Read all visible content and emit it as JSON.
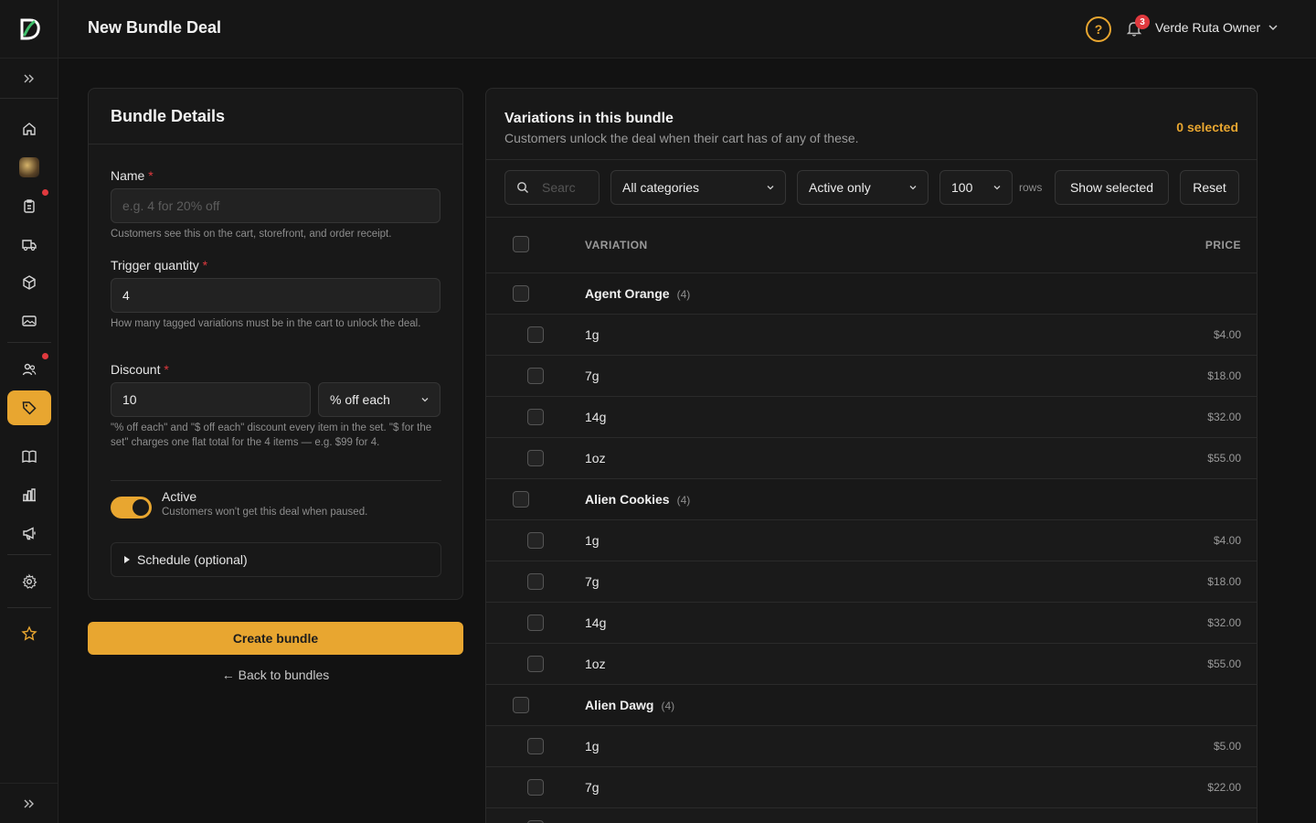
{
  "header": {
    "title": "New Bundle Deal",
    "help_glyph": "?",
    "notification_count": "3",
    "user_name": "Verde Ruta Owner"
  },
  "sidebar": {
    "items": [
      {
        "icon": "home-icon"
      },
      {
        "icon": "store-avatar-icon"
      },
      {
        "icon": "orders-clipboard-icon",
        "badge": true
      },
      {
        "icon": "delivery-truck-icon"
      },
      {
        "icon": "product-box-icon"
      },
      {
        "icon": "media-image-icon"
      },
      {
        "icon": "customers-icon",
        "badge": true
      },
      {
        "icon": "tag-icon",
        "active": true
      },
      {
        "icon": "catalog-book-icon"
      },
      {
        "icon": "analytics-chart-icon"
      },
      {
        "icon": "megaphone-icon"
      },
      {
        "icon": "settings-gear-icon"
      },
      {
        "icon": "star-icon"
      }
    ],
    "accent_color": "#e8a630",
    "badge_color": "#e0393e"
  },
  "details": {
    "title": "Bundle Details",
    "name_label": "Name",
    "name_placeholder": "e.g. 4 for 20% off",
    "name_help": "Customers see this on the cart, storefront, and order receipt.",
    "trigger_label": "Trigger quantity",
    "trigger_value": "4",
    "trigger_help": "How many tagged variations must be in the cart to unlock the deal.",
    "discount_label": "Discount",
    "discount_value": "10",
    "discount_type": "% off each",
    "discount_help": "\"% off each\" and \"$ off each\" discount every item in the set. \"$ for the set\" charges one flat total for the 4 items — e.g. $99 for 4.",
    "required_mark": "*",
    "active_title": "Active",
    "active_help": "Customers won't get this deal when paused.",
    "schedule_label": "Schedule (optional)"
  },
  "actions": {
    "create_label": "Create bundle",
    "back_label": "← Back to bundles"
  },
  "variations": {
    "title": "Variations in this bundle",
    "subtitle": "Customers unlock the deal when their cart has of any of these.",
    "selected_count": "0 selected",
    "search_placeholder": "Searc",
    "category_filter": "All categories",
    "status_filter": "Active only",
    "rows_value": "100",
    "rows_label": "rows",
    "show_selected_label": "Show selected",
    "reset_label": "Reset",
    "col_variation": "VARIATION",
    "col_price": "PRICE",
    "groups": [
      {
        "name": "Agent Orange",
        "count": "(4)",
        "items": [
          {
            "name": "1g",
            "price": "$4.00"
          },
          {
            "name": "7g",
            "price": "$18.00"
          },
          {
            "name": "14g",
            "price": "$32.00"
          },
          {
            "name": "1oz",
            "price": "$55.00"
          }
        ]
      },
      {
        "name": "Alien Cookies",
        "count": "(4)",
        "items": [
          {
            "name": "1g",
            "price": "$4.00"
          },
          {
            "name": "7g",
            "price": "$18.00"
          },
          {
            "name": "14g",
            "price": "$32.00"
          },
          {
            "name": "1oz",
            "price": "$55.00"
          }
        ]
      },
      {
        "name": "Alien Dawg",
        "count": "(4)",
        "items": [
          {
            "name": "1g",
            "price": "$5.00"
          },
          {
            "name": "7g",
            "price": "$22.00"
          }
        ]
      }
    ]
  }
}
